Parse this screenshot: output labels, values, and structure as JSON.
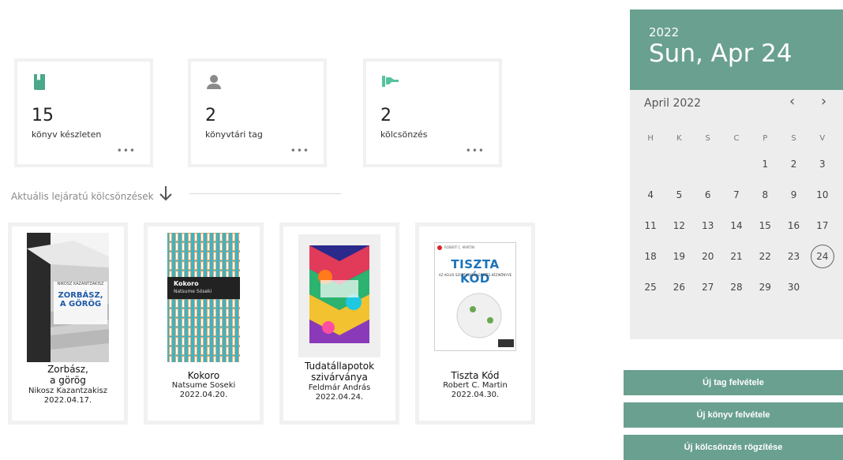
{
  "stats": [
    {
      "value": "15",
      "label": "könyv készleten",
      "more": "•••",
      "icon": "book-icon"
    },
    {
      "value": "2",
      "label": "könyvtári tag",
      "more": "•••",
      "icon": "user-icon"
    },
    {
      "value": "2",
      "label": "kölcsönzés",
      "more": "•••",
      "icon": "hand-icon"
    }
  ],
  "section": {
    "title": "Aktuális lejáratú kölcsönzések"
  },
  "books": [
    {
      "title_line1": "Zorbász,",
      "title_line2": "a görög",
      "author": "Nikosz Kazantzakisz",
      "due": "2022.04.17.",
      "cover_title": "ZORBÁSZ, A GÖRÖG",
      "cover_author": "NIKOSZ KAZANTZAKISZ"
    },
    {
      "title_line1": "Kokoro",
      "title_line2": "",
      "author": "Natsume Soseki",
      "due": "2022.04.20.",
      "cover_title": "Kokoro",
      "cover_author": "Natsume Sóseki"
    },
    {
      "title_line1": "Tudatállapotok",
      "title_line2": "szivárványa",
      "author": "Feldmár András",
      "due": "2022.04.24."
    },
    {
      "title_line1": "Tiszta Kód",
      "title_line2": "",
      "author": "Robert C. Martin",
      "due": "2022.04.30.",
      "cover_title": "TISZTA KÓD",
      "cover_author": "ROBERT C. MARTIN",
      "cover_subtitle": "AZ AGILIS SZOFTVERFEJLESZTÉS KÉZIKÖNYVE"
    }
  ],
  "calendar": {
    "year": "2022",
    "date": "Sun, Apr 24",
    "month_label": "April 2022",
    "prev": "‹",
    "next": "›",
    "weekdays": [
      "H",
      "K",
      "S",
      "C",
      "P",
      "S",
      "V"
    ],
    "weeks": [
      [
        "",
        "",
        "",
        "",
        "1",
        "2",
        "3"
      ],
      [
        "4",
        "5",
        "6",
        "7",
        "8",
        "9",
        "10"
      ],
      [
        "11",
        "12",
        "13",
        "14",
        "15",
        "16",
        "17"
      ],
      [
        "18",
        "19",
        "20",
        "21",
        "22",
        "23",
        "24"
      ],
      [
        "25",
        "26",
        "27",
        "28",
        "29",
        "30",
        ""
      ]
    ],
    "today": "24"
  },
  "actions": {
    "new_member": "Új tag felvétele",
    "new_book": "Új könyv felvétele",
    "new_loan": "Új kölcsönzés rögzítése"
  },
  "colors": {
    "accent": "#6aa08f",
    "icon_green": "#4aa88a",
    "icon_gray": "#8a8a8a",
    "icon_mint": "#56c2a0"
  }
}
